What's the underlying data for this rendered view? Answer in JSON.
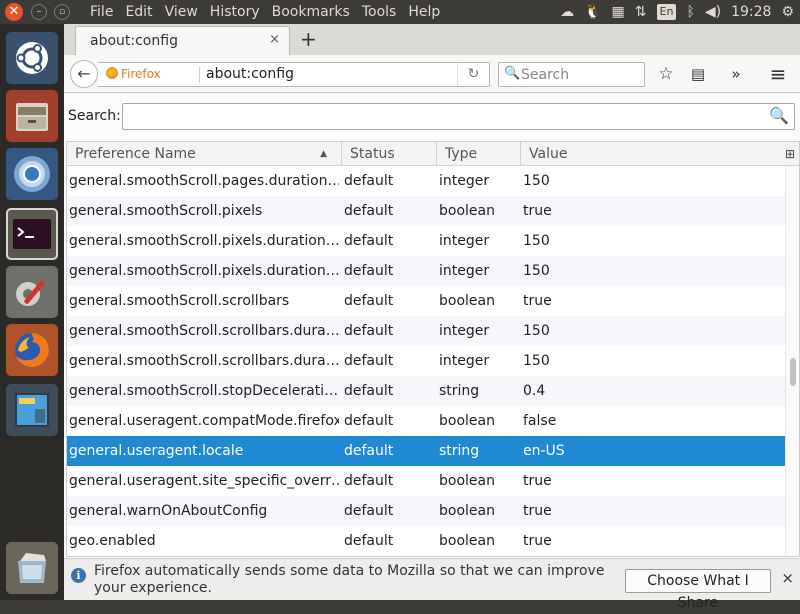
{
  "topbar": {
    "close_glyph": "✕",
    "min_glyph": "–",
    "max_glyph": "▫",
    "menus": [
      "File",
      "Edit",
      "View",
      "History",
      "Bookmarks",
      "Tools",
      "Help"
    ],
    "keyboard_layout": "En",
    "clock": "19:28"
  },
  "launcher_icons": [
    "ubuntu-dash-icon",
    "files-icon",
    "chromium-icon",
    "terminal-icon",
    "system-settings-icon",
    "firefox-icon",
    "workspace-switcher-icon",
    "trash-icon"
  ],
  "tab": {
    "title": "about:config",
    "close_glyph": "×",
    "new_tab_glyph": "+"
  },
  "navbar": {
    "identity_label": "Firefox",
    "url": "about:config",
    "search_placeholder": "Search"
  },
  "filter": {
    "label": "Search:",
    "value": ""
  },
  "columns": [
    "Preference Name",
    "Status",
    "Type",
    "Value"
  ],
  "sort_indicator": "▲",
  "preferences": [
    {
      "name": "general.smoothScroll.pages.duration…",
      "status": "default",
      "type": "integer",
      "value": "150"
    },
    {
      "name": "general.smoothScroll.pixels",
      "status": "default",
      "type": "boolean",
      "value": "true"
    },
    {
      "name": "general.smoothScroll.pixels.duration…",
      "status": "default",
      "type": "integer",
      "value": "150"
    },
    {
      "name": "general.smoothScroll.pixels.duration…",
      "status": "default",
      "type": "integer",
      "value": "150"
    },
    {
      "name": "general.smoothScroll.scrollbars",
      "status": "default",
      "type": "boolean",
      "value": "true"
    },
    {
      "name": "general.smoothScroll.scrollbars.dura…",
      "status": "default",
      "type": "integer",
      "value": "150"
    },
    {
      "name": "general.smoothScroll.scrollbars.dura…",
      "status": "default",
      "type": "integer",
      "value": "150"
    },
    {
      "name": "general.smoothScroll.stopDecelerati…",
      "status": "default",
      "type": "string",
      "value": "0.4"
    },
    {
      "name": "general.useragent.compatMode.firefox",
      "status": "default",
      "type": "boolean",
      "value": "false"
    },
    {
      "name": "general.useragent.locale",
      "status": "default",
      "type": "string",
      "value": "en-US"
    },
    {
      "name": "general.useragent.site_specific_overr…",
      "status": "default",
      "type": "boolean",
      "value": "true"
    },
    {
      "name": "general.warnOnAboutConfig",
      "status": "default",
      "type": "boolean",
      "value": "true"
    },
    {
      "name": "geo.enabled",
      "status": "default",
      "type": "boolean",
      "value": "true"
    }
  ],
  "selected_row": 9,
  "scroll_position": 0.53,
  "colors": {
    "selection": "#1f8ad2",
    "launcher_bg": "#2b2a26",
    "panel_bg": "#3c3b37"
  },
  "notification": {
    "text": "Firefox automatically sends some data to Mozilla so that we can improve your experience.",
    "button": "Choose What I Share",
    "close_glyph": "×"
  }
}
